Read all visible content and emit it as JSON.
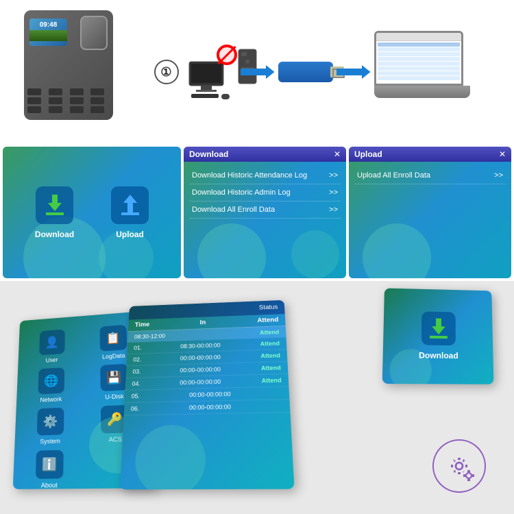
{
  "device": {
    "time": "09:48"
  },
  "flow": {
    "step_number": "①"
  },
  "panel_icons": {
    "download_label": "Download",
    "upload_label": "Upload"
  },
  "download_panel": {
    "title": "Download",
    "close": "✕",
    "items": [
      {
        "label": "Download Historic Attendance Log",
        "arrow": ">>"
      },
      {
        "label": "Download Historic Admin Log",
        "arrow": ">>"
      },
      {
        "label": "Download All Enroll Data",
        "arrow": ">>"
      }
    ]
  },
  "upload_panel": {
    "title": "Upload",
    "close": "✕",
    "items": [
      {
        "label": "Upload All Enroll Data",
        "arrow": ">>"
      }
    ]
  },
  "card_log": {
    "col1": "Time",
    "col2": "Status",
    "col3": "In",
    "col4": "Attend",
    "highlight_time": "08:30-12:00",
    "rows": [
      {
        "num": "01.",
        "time": "08:30-00:00",
        "status": "Attend"
      },
      {
        "num": "02.",
        "time": "00:00-00:00",
        "status": "Attend"
      },
      {
        "num": "03.",
        "time": "00:00-00:00",
        "status": "Attend"
      },
      {
        "num": "04.",
        "time": "00:00-00:00",
        "status": "Attend"
      },
      {
        "num": "05.",
        "time": "00:00-00:00",
        "status": ""
      },
      {
        "num": "06.",
        "time": "00:00-00:00",
        "status": ""
      }
    ]
  },
  "card_menu": {
    "items": [
      {
        "icon": "👤",
        "label": "User"
      },
      {
        "icon": "📋",
        "label": "LogData"
      },
      {
        "icon": "🌐",
        "label": "Network"
      },
      {
        "icon": "💾",
        "label": "U-Disk"
      },
      {
        "icon": "🔧",
        "label": "System"
      },
      {
        "icon": "📊",
        "label": "ACS"
      },
      {
        "icon": "ℹ️",
        "label": "About"
      }
    ]
  },
  "card_download": {
    "label": "Download"
  }
}
